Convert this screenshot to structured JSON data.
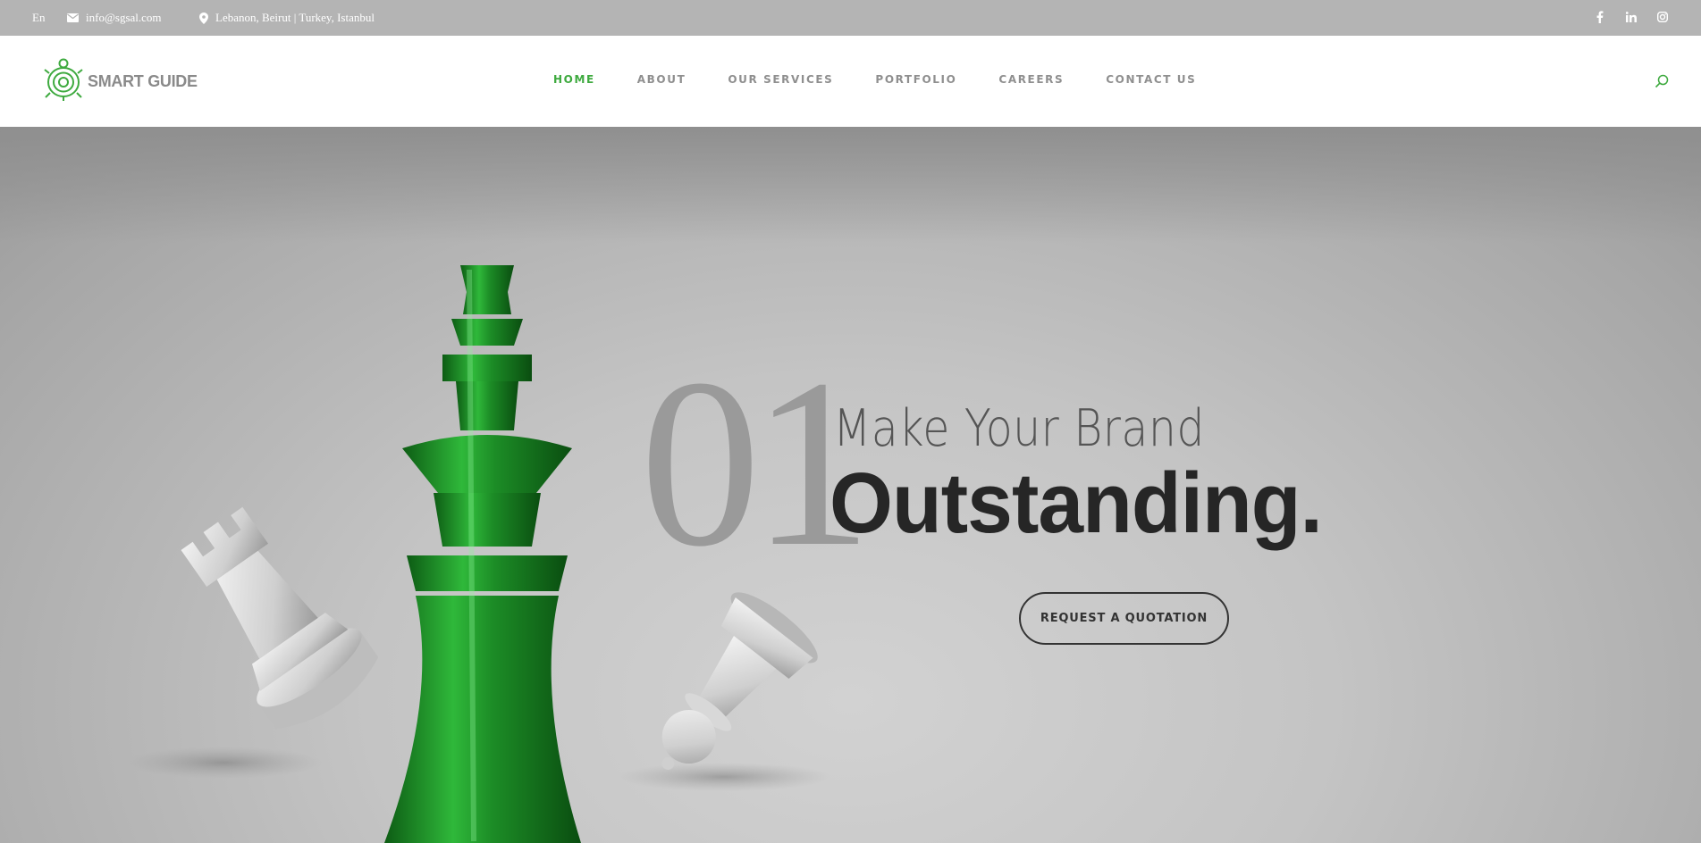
{
  "topbar": {
    "language": "En",
    "email": "info@sgsal.com",
    "location": "Lebanon, Beirut | Turkey, Istanbul",
    "social": [
      "f",
      "in",
      "ig"
    ]
  },
  "header": {
    "logo_text": "SMART GUIDE",
    "nav": [
      {
        "label": "HOME",
        "active": true
      },
      {
        "label": "ABOUT"
      },
      {
        "label": "OUR SERVICES"
      },
      {
        "label": "PORTFOLIO"
      },
      {
        "label": "CAREERS"
      },
      {
        "label": "CONTACT US"
      }
    ]
  },
  "hero": {
    "slide_number": "01",
    "headline_line1": "Make Your Brand",
    "headline_line2": "Outstanding.",
    "cta_label": "REQUEST A QUOTATION"
  },
  "colors": {
    "brand_green": "#3eaa3f",
    "topbar_bg": "#b4b4b4",
    "headline_dark": "#262626"
  },
  "icons": [
    "mail-icon",
    "location-pin-icon",
    "facebook-icon",
    "linkedin-icon",
    "instagram-icon",
    "search-icon",
    "chess-king-icon",
    "chess-rook-icon",
    "chess-pawn-icon"
  ]
}
